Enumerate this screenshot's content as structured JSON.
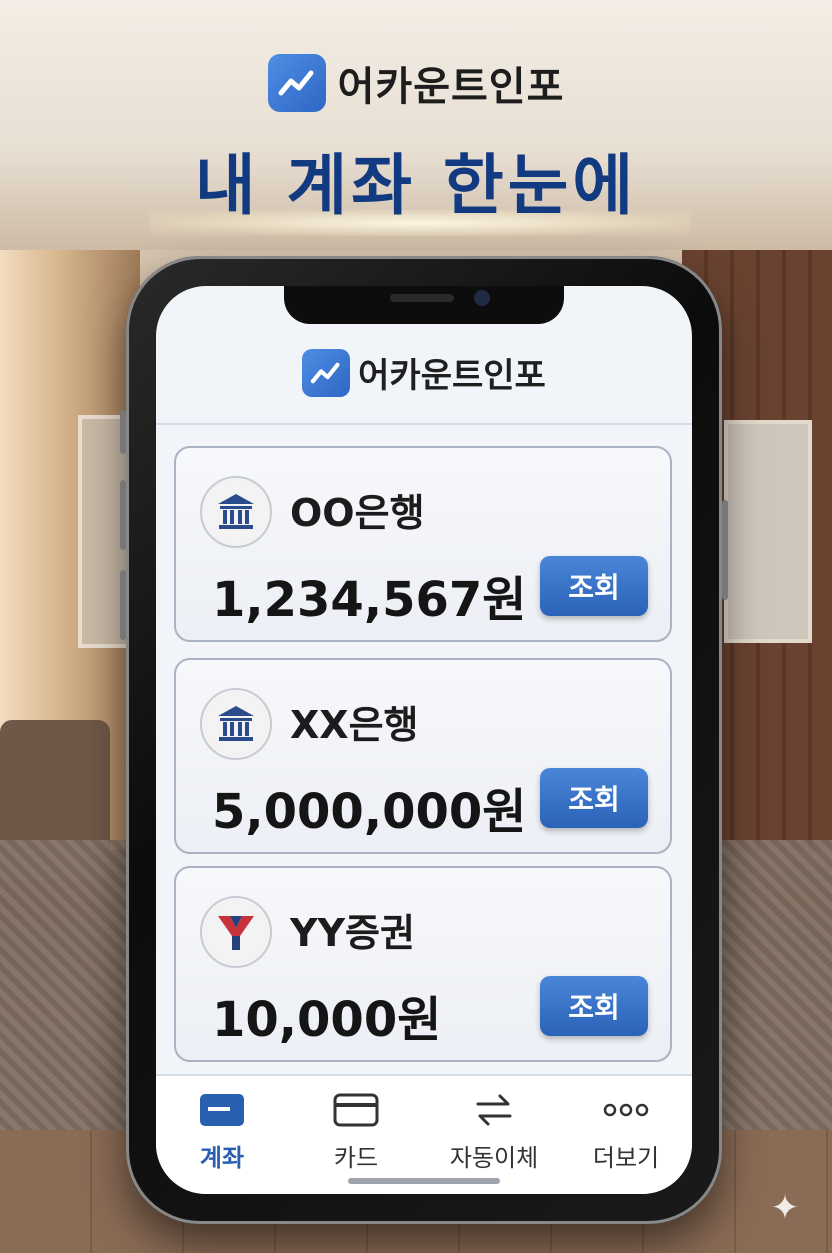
{
  "brand": {
    "name": "어카운트인포"
  },
  "headline": "내 계좌 한눈에",
  "app": {
    "brand_name": "어카운트인포"
  },
  "accounts": [
    {
      "name": "OO은행",
      "balance": "1,234,567원",
      "button": "조회",
      "icon": "bank-icon",
      "icon_color": "#2a4c8c"
    },
    {
      "name": "XX은행",
      "balance": "5,000,000원",
      "button": "조회",
      "icon": "bank-icon",
      "icon_color": "#2a4c8c"
    },
    {
      "name": "YY증권",
      "balance": "10,000원",
      "button": "조회",
      "icon": "securities-logo-icon",
      "icon_color": "#c8323b"
    }
  ],
  "tabs": [
    {
      "label": "계좌",
      "icon": "account-card-icon",
      "active": true
    },
    {
      "label": "카드",
      "icon": "credit-card-icon",
      "active": false
    },
    {
      "label": "자동이체",
      "icon": "transfer-arrows-icon",
      "active": false
    },
    {
      "label": "더보기",
      "icon": "more-dots-icon",
      "active": false
    }
  ],
  "colors": {
    "accent": "#2a62b8",
    "headline": "#123a80",
    "card_border": "#a9b3c4"
  }
}
